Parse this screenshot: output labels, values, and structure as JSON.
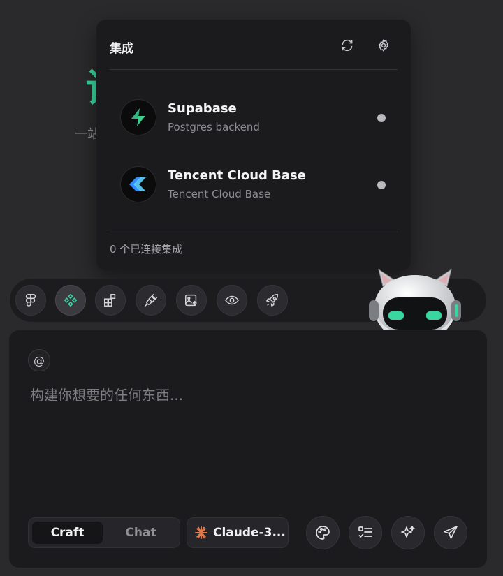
{
  "background": {
    "hero_char": "试",
    "hero_sub_left": "一站",
    "hero_sub_right": "。"
  },
  "integrations_popup": {
    "title": "集成",
    "refresh_icon": "refresh-icon",
    "settings_icon": "gear-icon",
    "items": [
      {
        "name": "Supabase",
        "description": "Postgres backend",
        "icon": "supabase-logo",
        "status_color": "#b9b9be"
      },
      {
        "name": "Tencent Cloud Base",
        "description": "Tencent Cloud Base",
        "icon": "tencent-cloudbase-logo",
        "status_color": "#b9b9be"
      }
    ],
    "footer": "0 个已连接集成"
  },
  "toolbar": {
    "tools": [
      {
        "icon": "figma-icon",
        "active": false
      },
      {
        "icon": "integrations-icon",
        "active": true
      },
      {
        "icon": "components-icon",
        "active": false
      },
      {
        "icon": "plug-icon",
        "active": false
      },
      {
        "icon": "image-upload-icon",
        "active": false
      },
      {
        "icon": "eye-icon",
        "active": false
      },
      {
        "icon": "rocket-icon",
        "active": false
      }
    ]
  },
  "composer": {
    "mention_symbol": "@",
    "placeholder": "构建你想要的任何东西...",
    "value": "",
    "modes": [
      "Craft",
      "Chat"
    ],
    "active_mode": "Craft",
    "model_label": "Claude-3...",
    "actions": [
      "palette-icon",
      "checklist-icon",
      "sparkle-icon",
      "send-icon"
    ]
  },
  "colors": {
    "accent_green": "#3ad6a0",
    "background": "#2a2a2c",
    "panel": "#1b1b1d",
    "claude_orange": "#e07a4f"
  }
}
